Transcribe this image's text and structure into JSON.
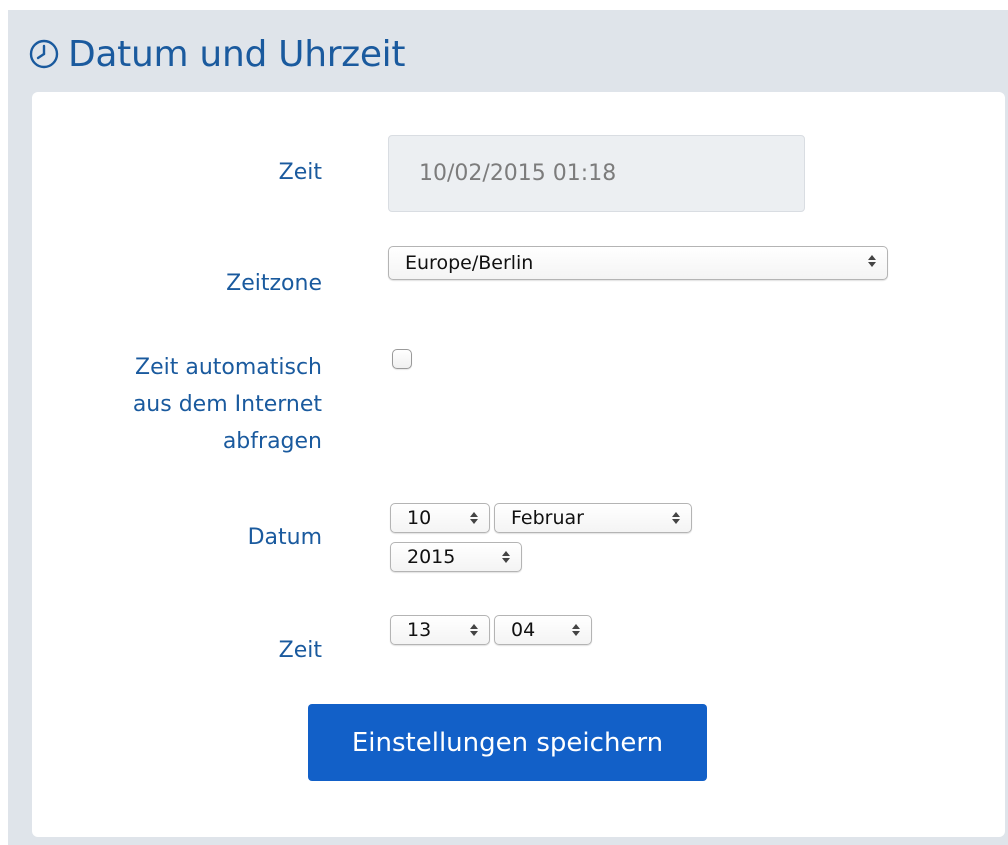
{
  "header": {
    "title": "Datum und Uhrzeit",
    "icon": "clock-icon"
  },
  "colors": {
    "accent": "#1a5a9e",
    "button": "#1260c8",
    "background": "#dfe4ea"
  },
  "form": {
    "current_time": {
      "label": "Zeit",
      "value": "10/02/2015 01:18"
    },
    "timezone": {
      "label": "Zeitzone",
      "value": "Europe/Berlin"
    },
    "auto_time": {
      "label_lines": [
        "Zeit automatisch",
        "aus dem Internet",
        "abfragen"
      ],
      "checked": false
    },
    "date": {
      "label": "Datum",
      "day": "10",
      "month": "Februar",
      "year": "2015"
    },
    "time": {
      "label": "Zeit",
      "hour": "13",
      "minute": "04"
    },
    "save_label": "Einstellungen speichern"
  }
}
